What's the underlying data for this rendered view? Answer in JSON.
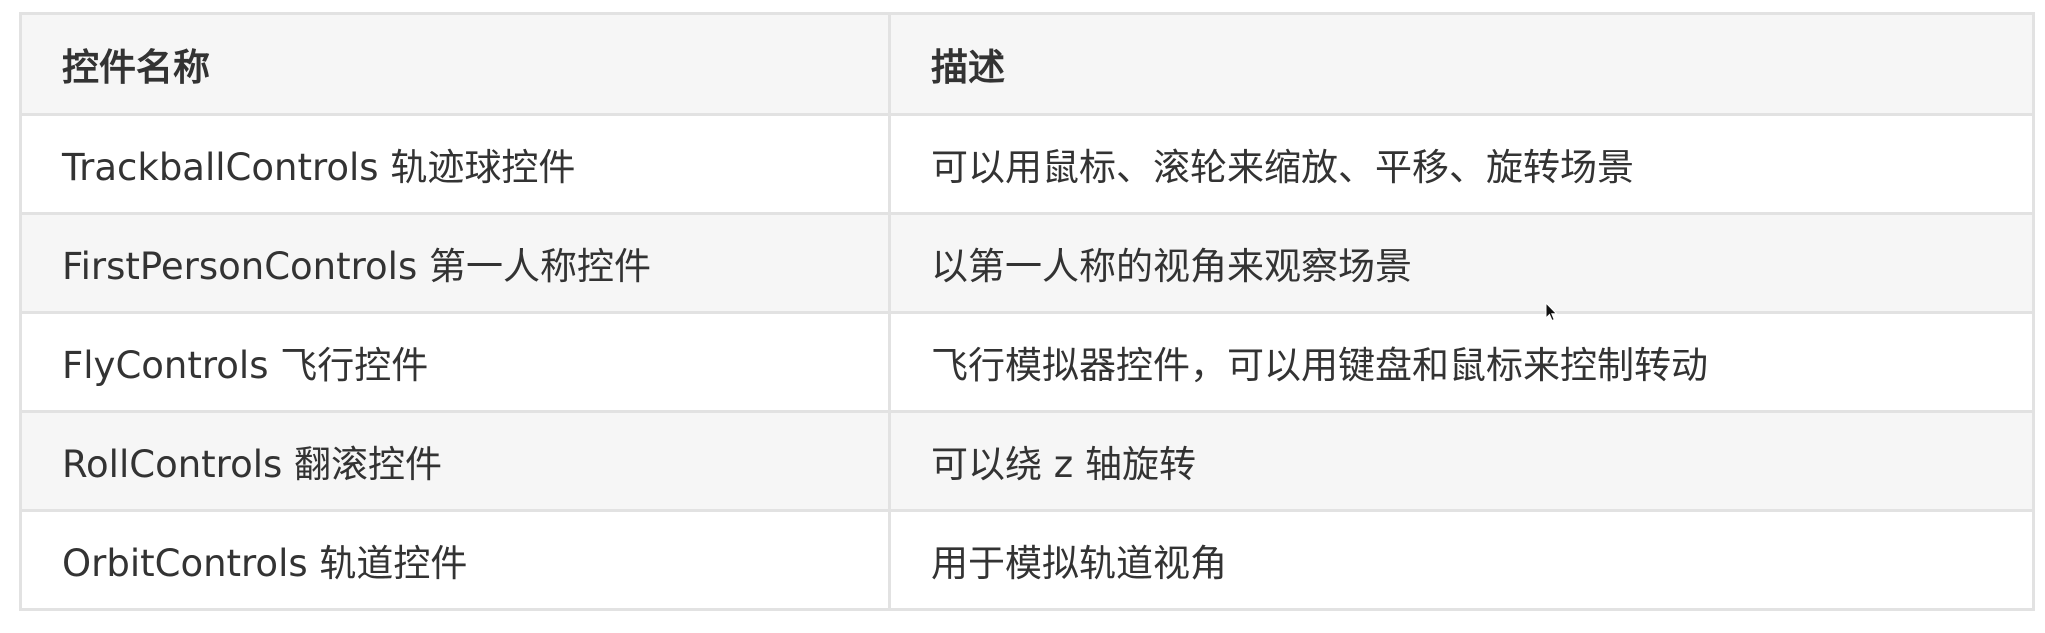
{
  "table": {
    "headers": [
      "控件名称",
      "描述"
    ],
    "rows": [
      {
        "name": "TrackballControls 轨迹球控件",
        "desc": "可以用鼠标、滚轮来缩放、平移、旋转场景"
      },
      {
        "name": "FirstPersonControls 第一人称控件",
        "desc": "以第一人称的视角来观察场景"
      },
      {
        "name": "FlyControls 飞行控件",
        "desc": "飞行模拟器控件，可以用键盘和鼠标来控制转动"
      },
      {
        "name": "RollControls 翻滚控件",
        "desc": "可以绕 z 轴旋转"
      },
      {
        "name": "OrbitControls 轨道控件",
        "desc": "用于模拟轨道视角"
      }
    ]
  },
  "colors": {
    "border": "#e2e2e2",
    "header_bg": "#f6f6f6",
    "alt_row_bg": "#f6f6f6",
    "text": "#333333"
  },
  "cursor_icon": "mouse-pointer-icon"
}
